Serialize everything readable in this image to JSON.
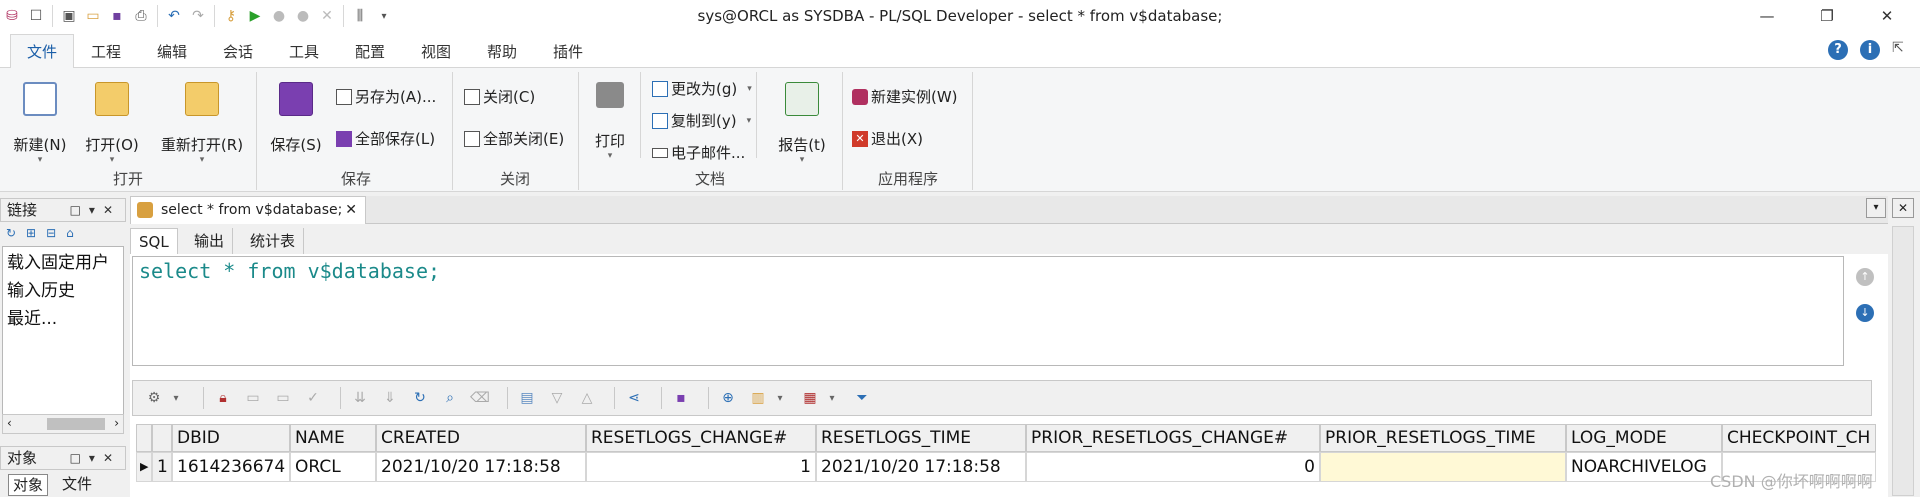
{
  "window": {
    "title": "sys@ORCL as SYSDBA - PL/SQL Developer - select * from v$database;",
    "minimize": "—",
    "restore": "❐",
    "close": "✕"
  },
  "menu": {
    "tabs": [
      "文件",
      "工程",
      "编辑",
      "会话",
      "工具",
      "配置",
      "视图",
      "帮助",
      "插件"
    ],
    "active": "文件"
  },
  "ribbon": {
    "open_group": {
      "label": "打开",
      "new": "新建(N)",
      "open": "打开(O)",
      "reopen": "重新打开(R)"
    },
    "save_group": {
      "label": "保存",
      "save": "保存(S)",
      "save_as": "另存为(A)...",
      "save_all": "全部保存(L)"
    },
    "close_group": {
      "label": "关闭",
      "close": "关闭(C)",
      "close_all": "全部关闭(E)"
    },
    "doc_group": {
      "label": "文档",
      "print": "打印",
      "change_to": "更改为(g)",
      "copy_to": "复制到(y)",
      "email": "电子邮件...",
      "report": "报告(t)"
    },
    "app_group": {
      "label": "应用程序",
      "new_instance": "新建实例(W)",
      "exit": "退出(X)"
    }
  },
  "left_panel": {
    "connections_title": "链接",
    "items": [
      "载入固定用户",
      "输入历史",
      "最近..."
    ],
    "objects_title": "对象",
    "object_tabs": [
      "对象",
      "文件"
    ]
  },
  "editor": {
    "doc_tab": "select * from v$database;",
    "sub_tabs": [
      "SQL",
      "输出",
      "统计表"
    ],
    "active_sub_tab": "SQL",
    "sql": "select * from v$database;"
  },
  "grid": {
    "columns": [
      "DBID",
      "NAME",
      "CREATED",
      "RESETLOGS_CHANGE#",
      "RESETLOGS_TIME",
      "PRIOR_RESETLOGS_CHANGE#",
      "PRIOR_RESETLOGS_TIME",
      "LOG_MODE",
      "CHECKPOINT_CH"
    ],
    "rows": [
      {
        "num": "1",
        "values": [
          "1614236674",
          "ORCL",
          "2021/10/20 17:18:58",
          "1",
          "2021/10/20 17:18:58",
          "0",
          "",
          "NOARCHIVELOG",
          ""
        ]
      }
    ]
  },
  "watermark": "CSDN @你坏啊啊啊啊",
  "colors": {
    "accent": "#1a5ea8",
    "sql_text": "#1b8a8a",
    "null_cell": "#fff9d6"
  }
}
